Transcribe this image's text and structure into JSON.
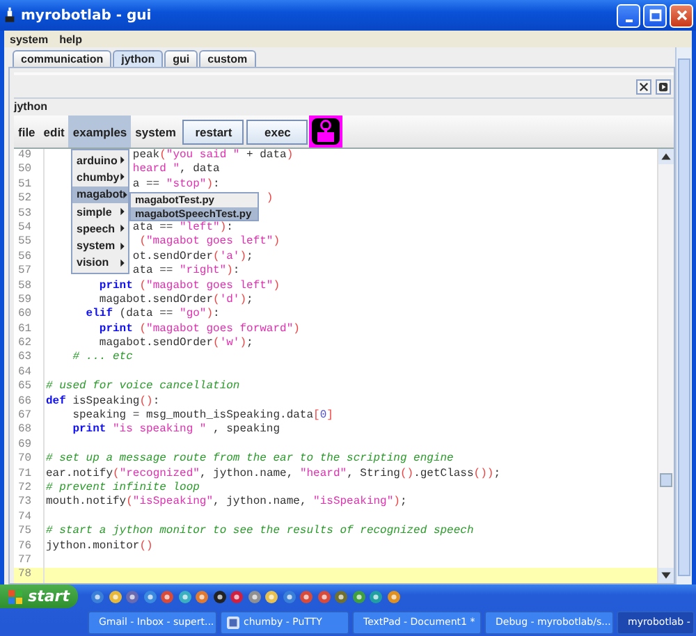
{
  "window": {
    "title": "myrobotlab - gui"
  },
  "menu_bar": [
    "system",
    "help"
  ],
  "tabs": [
    {
      "label": "communication",
      "selected": false
    },
    {
      "label": "jython",
      "selected": true
    },
    {
      "label": "gui",
      "selected": false
    },
    {
      "label": "custom",
      "selected": false
    }
  ],
  "panel": {
    "title": "jython"
  },
  "toolbar": {
    "menus": [
      {
        "label": "file",
        "selected": false
      },
      {
        "label": "edit",
        "selected": false
      },
      {
        "label": "examples",
        "selected": true
      },
      {
        "label": "system",
        "selected": false
      }
    ],
    "buttons": [
      "restart",
      "exec"
    ]
  },
  "examples_menu": {
    "items": [
      {
        "label": "arduino",
        "selected": false
      },
      {
        "label": "chumby",
        "selected": false
      },
      {
        "label": "magabot",
        "selected": true
      },
      {
        "label": "simple",
        "selected": false
      },
      {
        "label": "speech",
        "selected": false
      },
      {
        "label": "system",
        "selected": false
      },
      {
        "label": "vision",
        "selected": false
      }
    ],
    "submenu": [
      {
        "label": "magabotTest.py",
        "selected": false
      },
      {
        "label": "magabotSpeechTest.py",
        "selected": true
      }
    ]
  },
  "editor": {
    "lines": [
      {
        "number": "49",
        "current": false,
        "tokens": [
          {
            "kind": "plain",
            "text": "             peak"
          },
          {
            "kind": "paren",
            "text": "("
          },
          {
            "kind": "str",
            "text": "\"you said \""
          },
          {
            "kind": "plain",
            "text": " + data"
          },
          {
            "kind": "paren",
            "text": ")"
          }
        ]
      },
      {
        "number": "50",
        "current": false,
        "tokens": [
          {
            "kind": "str",
            "text": "             heard \""
          },
          {
            "kind": "plain",
            "text": ", data"
          }
        ]
      },
      {
        "number": "51",
        "current": false,
        "tokens": [
          {
            "kind": "plain",
            "text": "             a == "
          },
          {
            "kind": "str",
            "text": "\"stop\""
          },
          {
            "kind": "paren",
            "text": ")"
          },
          {
            "kind": "plain",
            "text": ":"
          }
        ]
      },
      {
        "number": "52",
        "current": false,
        "tokens": [
          {
            "kind": "paren",
            "text": "                                 )"
          }
        ]
      },
      {
        "number": "53",
        "current": false
      },
      {
        "number": "54",
        "current": false,
        "tokens": [
          {
            "kind": "plain",
            "text": "             ata == "
          },
          {
            "kind": "str",
            "text": "\"left\""
          },
          {
            "kind": "paren",
            "text": ")"
          },
          {
            "kind": "plain",
            "text": ":"
          }
        ]
      },
      {
        "number": "55",
        "current": false,
        "tokens": [
          {
            "kind": "paren",
            "text": "              ("
          },
          {
            "kind": "str",
            "text": "\"magabot goes left\""
          },
          {
            "kind": "paren",
            "text": ")"
          }
        ]
      },
      {
        "number": "56",
        "current": false,
        "tokens": [
          {
            "kind": "plain",
            "text": "             ot.sendOrder"
          },
          {
            "kind": "paren",
            "text": "("
          },
          {
            "kind": "str",
            "text": "'a'"
          },
          {
            "kind": "paren",
            "text": ")"
          },
          {
            "kind": "plain",
            "text": ";"
          }
        ]
      },
      {
        "number": "57",
        "current": false,
        "tokens": [
          {
            "kind": "plain",
            "text": "             ata == "
          },
          {
            "kind": "str",
            "text": "\"right\""
          },
          {
            "kind": "paren",
            "text": ")"
          },
          {
            "kind": "plain",
            "text": ":"
          }
        ]
      },
      {
        "number": "58",
        "current": false,
        "tokens": [
          {
            "kind": "kw",
            "text": "        print"
          },
          {
            "kind": "paren",
            "text": " ("
          },
          {
            "kind": "str",
            "text": "\"magabot goes left\""
          },
          {
            "kind": "paren",
            "text": ")"
          }
        ]
      },
      {
        "number": "59",
        "current": false,
        "tokens": [
          {
            "kind": "plain",
            "text": "        magabot.sendOrder"
          },
          {
            "kind": "paren",
            "text": "("
          },
          {
            "kind": "str",
            "text": "'d'"
          },
          {
            "kind": "paren",
            "text": ")"
          },
          {
            "kind": "plain",
            "text": ";"
          }
        ]
      },
      {
        "number": "60",
        "current": false,
        "tokens": [
          {
            "kind": "kw",
            "text": "      elif"
          },
          {
            "kind": "plain",
            "text": " (data == "
          },
          {
            "kind": "str",
            "text": "\"go\""
          },
          {
            "kind": "paren",
            "text": ")"
          },
          {
            "kind": "plain",
            "text": ":"
          }
        ]
      },
      {
        "number": "61",
        "current": false,
        "tokens": [
          {
            "kind": "kw",
            "text": "        print"
          },
          {
            "kind": "paren",
            "text": " ("
          },
          {
            "kind": "str",
            "text": "\"magabot goes forward\""
          },
          {
            "kind": "paren",
            "text": ")"
          }
        ]
      },
      {
        "number": "62",
        "current": false,
        "tokens": [
          {
            "kind": "plain",
            "text": "        magabot.sendOrder"
          },
          {
            "kind": "paren",
            "text": "("
          },
          {
            "kind": "str",
            "text": "'w'"
          },
          {
            "kind": "paren",
            "text": ")"
          },
          {
            "kind": "plain",
            "text": ";"
          }
        ]
      },
      {
        "number": "63",
        "current": false,
        "tokens": [
          {
            "kind": "com",
            "text": "    # ... etc"
          }
        ]
      },
      {
        "number": "64",
        "current": false
      },
      {
        "number": "65",
        "current": false,
        "tokens": [
          {
            "kind": "com",
            "text": "# used for voice cancellation"
          }
        ]
      },
      {
        "number": "66",
        "current": false,
        "tokens": [
          {
            "kind": "kw",
            "text": "def"
          },
          {
            "kind": "plain",
            "text": " isSpeaking"
          },
          {
            "kind": "paren",
            "text": "()"
          },
          {
            "kind": "plain",
            "text": ":"
          }
        ]
      },
      {
        "number": "67",
        "current": false,
        "tokens": [
          {
            "kind": "plain",
            "text": "    speaking = msg_mouth_isSpeaking.data"
          },
          {
            "kind": "paren",
            "text": "["
          },
          {
            "kind": "num",
            "text": "0"
          },
          {
            "kind": "paren",
            "text": "]"
          }
        ]
      },
      {
        "number": "68",
        "current": false,
        "tokens": [
          {
            "kind": "kw",
            "text": "    print"
          },
          {
            "kind": "str",
            "text": " \"is speaking \""
          },
          {
            "kind": "plain",
            "text": " , speaking"
          }
        ]
      },
      {
        "number": "69",
        "current": false
      },
      {
        "number": "70",
        "current": false,
        "tokens": [
          {
            "kind": "com",
            "text": "# set up a message route from the ear to the scripting engine"
          }
        ]
      },
      {
        "number": "71",
        "current": false,
        "tokens": [
          {
            "kind": "plain",
            "text": "ear.notify"
          },
          {
            "kind": "paren",
            "text": "("
          },
          {
            "kind": "str",
            "text": "\"recognized\""
          },
          {
            "kind": "plain",
            "text": ", jython.name, "
          },
          {
            "kind": "str",
            "text": "\"heard\""
          },
          {
            "kind": "plain",
            "text": ", String"
          },
          {
            "kind": "paren",
            "text": "()"
          },
          {
            "kind": "plain",
            "text": ".getClass"
          },
          {
            "kind": "paren",
            "text": "())"
          },
          {
            "kind": "plain",
            "text": ";"
          }
        ]
      },
      {
        "number": "72",
        "current": false,
        "tokens": [
          {
            "kind": "com",
            "text": "# prevent infinite loop"
          }
        ]
      },
      {
        "number": "73",
        "current": false,
        "tokens": [
          {
            "kind": "plain",
            "text": "mouth.notify"
          },
          {
            "kind": "paren",
            "text": "("
          },
          {
            "kind": "str",
            "text": "\"isSpeaking\""
          },
          {
            "kind": "plain",
            "text": ", jython.name, "
          },
          {
            "kind": "str",
            "text": "\"isSpeaking\""
          },
          {
            "kind": "paren",
            "text": ")"
          },
          {
            "kind": "plain",
            "text": ";"
          }
        ]
      },
      {
        "number": "74",
        "current": false
      },
      {
        "number": "75",
        "current": false,
        "tokens": [
          {
            "kind": "com",
            "text": "# start a jython monitor to see the results of recognized speech"
          }
        ]
      },
      {
        "number": "76",
        "current": false,
        "tokens": [
          {
            "kind": "plain",
            "text": "jython.monitor"
          },
          {
            "kind": "paren",
            "text": "()"
          }
        ]
      },
      {
        "number": "77",
        "current": false
      },
      {
        "number": "78",
        "current": true
      }
    ]
  },
  "taskbar": {
    "start": "start",
    "tasks": [
      {
        "label": "Gmail - Inbox - supert...",
        "selected": false
      },
      {
        "label": "chumby - PuTTY",
        "selected": false
      },
      {
        "label": "TextPad - Document1 *",
        "selected": false
      },
      {
        "label": "Debug - myrobotlab/s...",
        "selected": false
      },
      {
        "label": "myrobotlab -",
        "selected": true
      }
    ]
  }
}
